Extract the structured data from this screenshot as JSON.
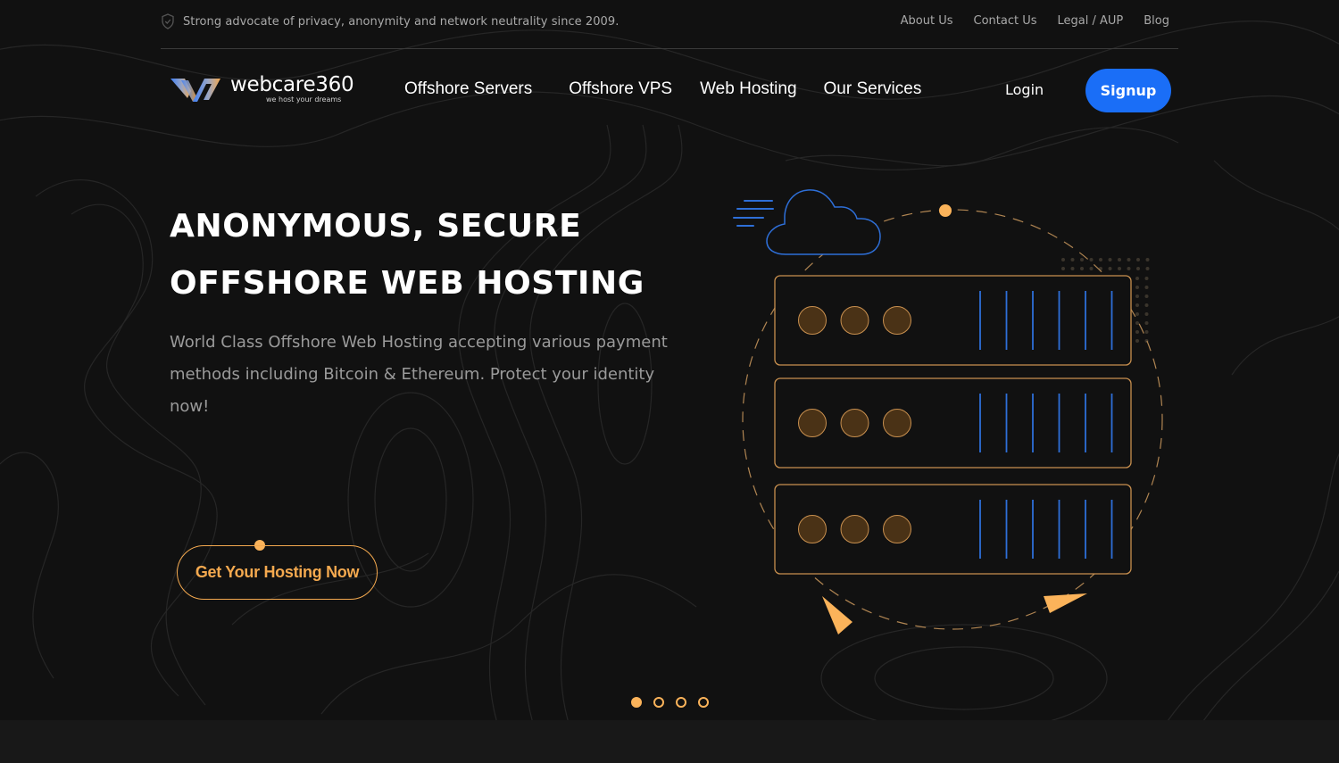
{
  "topbar": {
    "tagline_icon": "shield-check-icon",
    "tagline": "Strong advocate of privacy, anonymity and network neutrality since 2009.",
    "links": [
      {
        "label": "About Us"
      },
      {
        "label": "Contact Us"
      },
      {
        "label": "Legal / AUP"
      },
      {
        "label": "Blog"
      }
    ]
  },
  "brand": {
    "name": "webcare360",
    "tagline": "we host your dreams"
  },
  "nav": {
    "items": [
      {
        "label": "Offshore Servers"
      },
      {
        "label": "Offshore VPS"
      },
      {
        "label": "Web Hosting"
      },
      {
        "label": "Our Services"
      }
    ],
    "login_label": "Login",
    "signup_label": "Signup"
  },
  "hero": {
    "headline": "ANONYMOUS, SECURE OFFSHORE WEB HOSTING",
    "subtext": "World Class Offshore Web Hosting accepting various payment methods including Bitcoin & Ethereum. Protect your identity now!",
    "cta_label": "Get Your Hosting Now",
    "illustration": {
      "icons": [
        "cloud-icon",
        "server-rack-icon"
      ],
      "server_units": 3,
      "leds_per_unit": 3,
      "bars_per_unit": 6
    }
  },
  "slider": {
    "total_slides": 4,
    "active_index": 0
  },
  "colors": {
    "background": "#111111",
    "accent_orange": "#fbb35a",
    "accent_blue": "#1a6ef7",
    "muted_text": "#9a9a9a",
    "footer_band": "#181818"
  }
}
